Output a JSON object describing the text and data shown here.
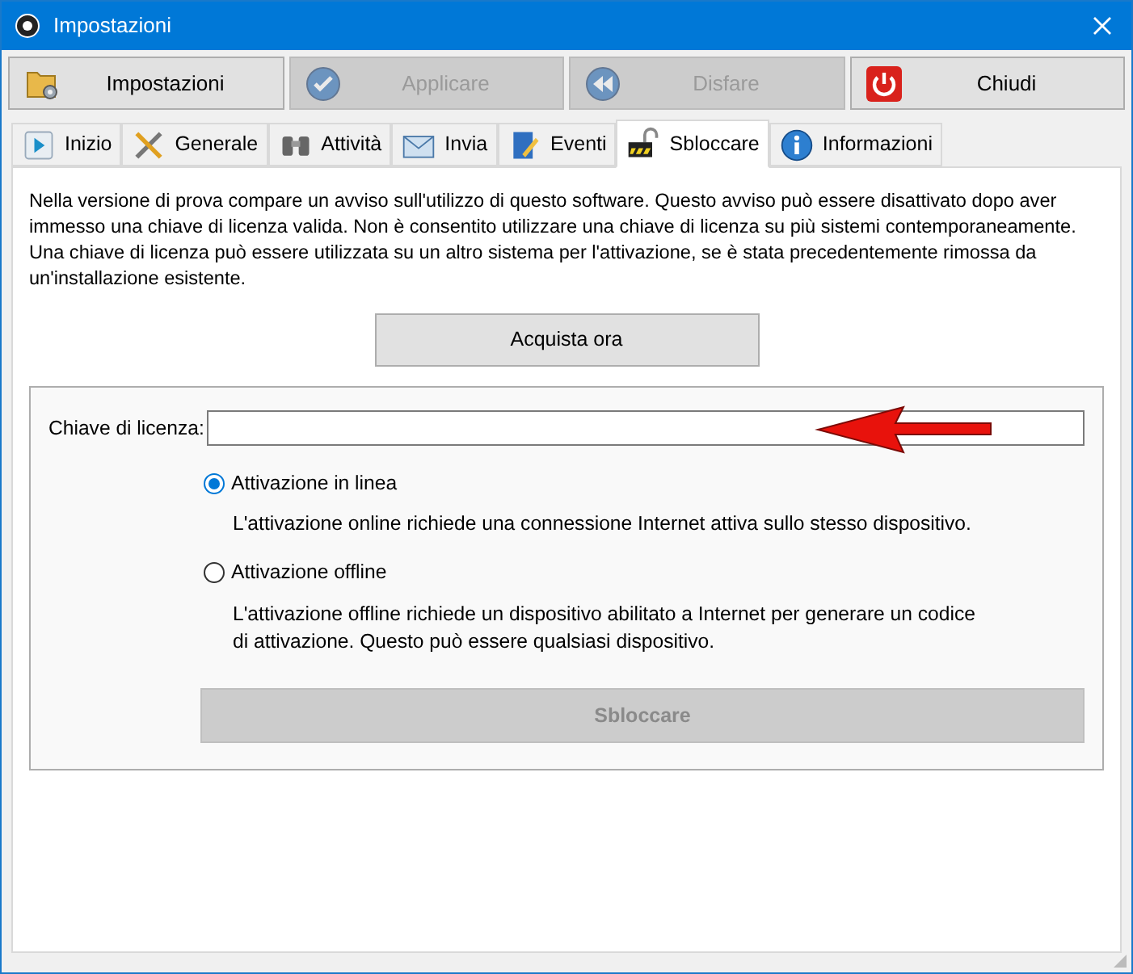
{
  "window": {
    "title": "Impostazioni"
  },
  "toolbar": [
    {
      "label": "Impostazioni",
      "kind": "folder",
      "disabled": false
    },
    {
      "label": "Applicare",
      "kind": "check",
      "disabled": true
    },
    {
      "label": "Disfare",
      "kind": "rewind",
      "disabled": true
    },
    {
      "label": "Chiudi",
      "kind": "power",
      "disabled": false
    }
  ],
  "tabs": [
    {
      "label": "Inizio",
      "kind": "play",
      "selected": false
    },
    {
      "label": "Generale",
      "kind": "tools",
      "selected": false
    },
    {
      "label": "Attività",
      "kind": "binoculars",
      "selected": false
    },
    {
      "label": "Invia",
      "kind": "mail",
      "selected": false
    },
    {
      "label": "Eventi",
      "kind": "document",
      "selected": false
    },
    {
      "label": "Sbloccare",
      "kind": "lock",
      "selected": true
    },
    {
      "label": "Informazioni",
      "kind": "info",
      "selected": false
    }
  ],
  "description": "Nella versione di prova compare un avviso sull'utilizzo di questo software. Questo avviso può essere disattivato dopo aver immesso una chiave di licenza valida. Non è consentito utilizzare una chiave di licenza su più sistemi contemporaneamente. Una chiave di licenza può essere utilizzata su un altro sistema per l'attivazione, se è stata precedentemente rimossa da un'installazione esistente.",
  "buy_button": "Acquista ora",
  "license": {
    "label": "Chiave di licenza:"
  },
  "activation_options": [
    {
      "label": "Attivazione in linea",
      "description": "L'attivazione online richiede una connessione Internet attiva sullo stesso dispositivo.",
      "selected": true
    },
    {
      "label": "Attivazione offline",
      "description": "L'attivazione offline richiede un dispositivo abilitato a Internet per generare un codice di attivazione. Questo può essere qualsiasi dispositivo.",
      "selected": false
    }
  ],
  "unlock_button": {
    "label": "Sbloccare",
    "disabled": true
  }
}
